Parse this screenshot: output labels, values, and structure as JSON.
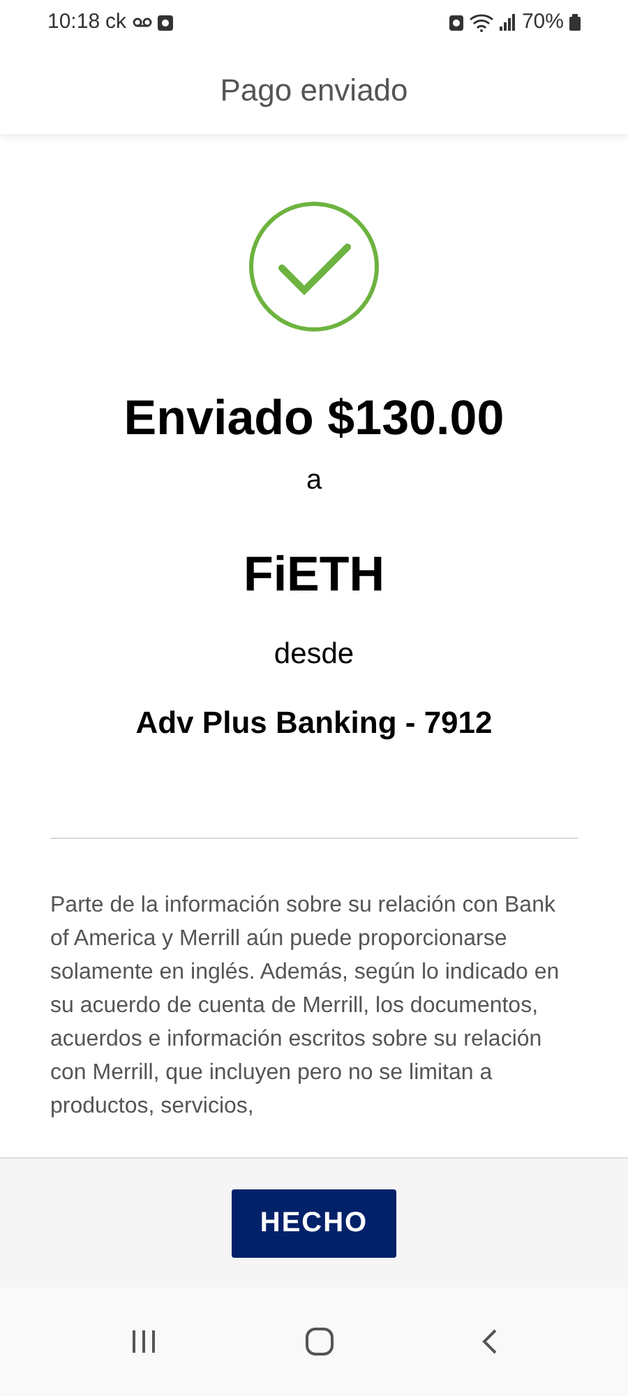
{
  "status_bar": {
    "time": "10:18",
    "carrier": "ck",
    "battery": "70%"
  },
  "header": {
    "title": "Pago enviado"
  },
  "confirmation": {
    "amount_line": "Enviado $130.00",
    "to_word": "a",
    "recipient": "FiETH",
    "from_word": "desde",
    "account": "Adv Plus Banking - 7912"
  },
  "disclaimer": "Parte de la información sobre su relación con Bank of America y Merrill aún puede proporcionarse solamente en inglés. Además, según lo indicado en su acuerdo de cuenta de Merrill, los documentos, acuerdos e información escritos sobre su relación con Merrill, que incluyen pero no se limitan a productos, servicios,",
  "footer": {
    "button": "HECHO"
  }
}
